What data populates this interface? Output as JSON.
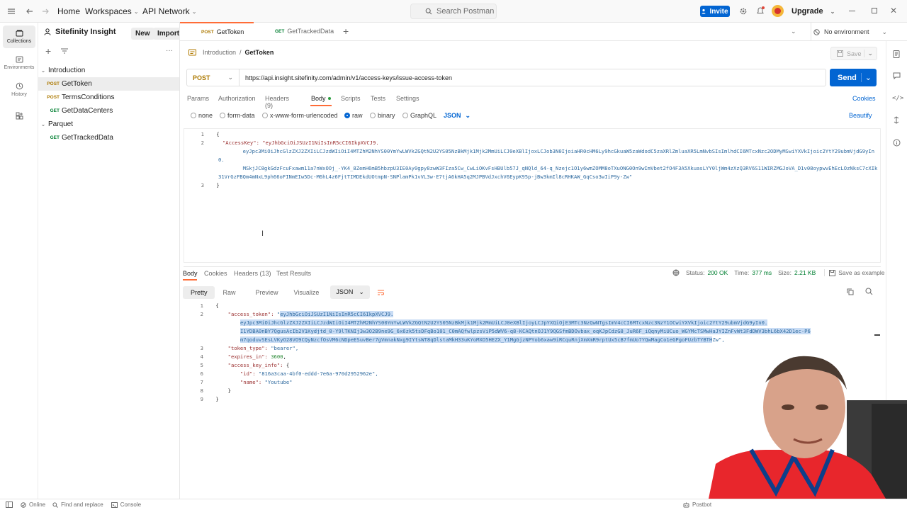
{
  "topbar": {
    "home": "Home",
    "workspaces": "Workspaces",
    "api_network": "API Network",
    "search_placeholder": "Search Postman",
    "invite": "Invite",
    "upgrade": "Upgrade"
  },
  "rail": {
    "items": [
      {
        "label": "Collections",
        "icon": "collections-icon"
      },
      {
        "label": "Environments",
        "icon": "environments-icon"
      },
      {
        "label": "History",
        "icon": "history-icon"
      },
      {
        "label": "",
        "icon": "apps-icon"
      }
    ]
  },
  "sidebar": {
    "workspace": "Sitefinity Insight",
    "new": "New",
    "import": "Import",
    "folders": [
      {
        "name": "Introduction",
        "requests": [
          {
            "method": "POST",
            "name": "GetToken"
          },
          {
            "method": "POST",
            "name": "TermsConditions"
          },
          {
            "method": "GET",
            "name": "GetDataCenters"
          }
        ]
      },
      {
        "name": "Parquet",
        "requests": [
          {
            "method": "GET",
            "name": "GetTrackedData"
          }
        ]
      }
    ]
  },
  "tabs": [
    {
      "method": "POST",
      "name": "GetToken"
    },
    {
      "method": "GET",
      "name": "GetTrackedData"
    }
  ],
  "environment": "No environment",
  "breadcrumb": {
    "parent": "Introduction",
    "sep": "/",
    "current": "GetToken"
  },
  "save": "Save",
  "request": {
    "method": "POST",
    "url": "https://api.insight.sitefinity.com/admin/v1/access-keys/issue-access-token",
    "send": "Send",
    "tabs": [
      "Params",
      "Authorization",
      "Headers (9)",
      "Body",
      "Scripts",
      "Tests",
      "Settings"
    ],
    "cookies": "Cookies",
    "body_modes": [
      "none",
      "form-data",
      "x-www-form-urlencoded",
      "raw",
      "binary",
      "GraphQL"
    ],
    "body_format": "JSON",
    "beautify": "Beautify",
    "body_lines": [
      "{",
      "    \"AccessKey\": \"eyJhbGciOiJSUzI1NiIsInR5cCI6IkpXVCJ9.",
      "        eyJpc3MiOiJhcGlzZXJ2ZXIiLCJzdWIiOiI4MTZhM2NhYS00YmYwLWVkZGQtN2U2YS05NzBkMjk1Mjk2MmUiLCJ0eXBlIjoxLCJob3N0IjoiaHR0cHM6Ly9hcGkuaW5zaWdodC5zaXRlZmluaXR5LmNvbSIsImlhdCI6MTcxNzc2ODMyMSwiYXVkIjoic2YtY29ubmVjdG9yIn0.",
      "        MSkjJC8gkGdzFcuFxawm11a7nWxOOj_-YK4_8ZemH6mB5hbzpU3IE0Ay0gpy8zwW3FIza5Cw_CwLiOKvFsHBUlb57J_qNQld_64-q_Nzejc1O1y6wmZOMM8oTXuONG0On9wImVbet2fO4F3A5XkuasLYY0ljWm4zXzQ3RV6S11WIRZMGJoVA_D1v08oypwvEhEcLOzNksC7cXIk31VrGzFBQm4mNxL9ph66oFINmEIw5Dc-M6hL4z6FjtTIMDEkdUOtmpN-SNPlamPk1vVL3w-E7tjA6kHA5q2MJPBVdJxchV6EypK95p-jBw3kmIl8cRHKAW_GqCso3wIiP9y-Zw\"",
      "}"
    ]
  },
  "response": {
    "tabs": [
      "Body",
      "Cookies",
      "Headers (13)",
      "Test Results"
    ],
    "status_label": "Status:",
    "status": "200 OK",
    "time_label": "Time:",
    "time": "377 ms",
    "size_label": "Size:",
    "size": "2.21 KB",
    "save_example": "Save as example",
    "views": [
      "Pretty",
      "Raw",
      "Preview",
      "Visualize"
    ],
    "format": "JSON",
    "lines": [
      {
        "n": "1",
        "parts": [
          {
            "t": "{",
            "c": ""
          }
        ]
      },
      {
        "n": "2",
        "parts": [
          {
            "t": "    \"access_token\": ",
            "c": "key"
          },
          {
            "t": "\"",
            "c": "str"
          },
          {
            "t": "eyJhbGciOiJSUzI1NiIsInR5cCI6IkpXVCJ9.",
            "c": "str sel"
          }
        ]
      },
      {
        "n": "",
        "parts": [
          {
            "t": "        ",
            "c": ""
          },
          {
            "t": "eyJpc3MiOiJhcGlzZXJ2ZXIiLCJzdWIiOiI4MTZhM2NhYS00YmYwLWVkZGQtN2U2YS05NzBkMjk1Mjk2MmUiLCJ0eXBlIjoyLCJpYXQiOjE3MTc3NzQwNTgsImV4cCI6MTcxNzc3NzY1OCwiYXVkIjoic2YtY29ubmVjdG9yIn0.",
            "c": "str sel"
          }
        ]
      },
      {
        "n": "",
        "parts": [
          {
            "t": "        ",
            "c": ""
          },
          {
            "t": "I1YDBA0nBY7QgusAcIb2V1Kydjtd_0-Y9lTKNIj3w3O2B9ne9G_6x6zk5tsDFqBo101_C0mAQfwlpzsViP5dWV6-q8-KCAQtnOJ1Y9QGSfmBDOvbax_oqKJpCdzG8_JuR6F_iQqnyMiUCuo_WGYMcTSMwHaJYIZnFvWt3FdDWV3bhL6bX42D1ec-P6",
            "c": "str sel"
          }
        ]
      },
      {
        "n": "",
        "parts": [
          {
            "t": "        ",
            "c": ""
          },
          {
            "t": "m7qoduvSEsLVKyO28VO9CQyNzcfOsVM6cNDpeESuvBer7gVmnakNxg9IYtsWT8qDlstaMkH33uKYoMXO5HEZX_Y1MgGjzNPYob6xaw9iRCquRnjXmXmR9rptUx5cB7fmUo7YQwMagCo1eGPgoFUzbTYBTH",
            "c": "str sel"
          },
          {
            "t": "Zw\",",
            "c": "str"
          }
        ]
      },
      {
        "n": "3",
        "parts": [
          {
            "t": "    \"token_type\": ",
            "c": "key"
          },
          {
            "t": "\"bearer\",",
            "c": "str"
          }
        ]
      },
      {
        "n": "4",
        "parts": [
          {
            "t": "    \"expires_in\": ",
            "c": "key"
          },
          {
            "t": "3600",
            "c": "num"
          },
          {
            "t": ",",
            "c": ""
          }
        ]
      },
      {
        "n": "5",
        "parts": [
          {
            "t": "    \"access_key_info\": ",
            "c": "key"
          },
          {
            "t": "{",
            "c": ""
          }
        ]
      },
      {
        "n": "6",
        "parts": [
          {
            "t": "        \"id\": ",
            "c": "key"
          },
          {
            "t": "\"816a3caa-4bf0-eddd-7e6a-970d2952962e\",",
            "c": "str"
          }
        ]
      },
      {
        "n": "7",
        "parts": [
          {
            "t": "        \"name\": ",
            "c": "key"
          },
          {
            "t": "\"Youtube\"",
            "c": "str"
          }
        ]
      },
      {
        "n": "8",
        "parts": [
          {
            "t": "    }",
            "c": ""
          }
        ]
      },
      {
        "n": "9",
        "parts": [
          {
            "t": "}",
            "c": ""
          }
        ]
      }
    ]
  },
  "footer": {
    "online": "Online",
    "find_replace": "Find and replace",
    "console": "Console",
    "postbot": "Postbot"
  },
  "colors": {
    "accent": "#0265d2",
    "post": "#ad7a03",
    "get": "#007f31",
    "status_ok": "#007f31"
  }
}
